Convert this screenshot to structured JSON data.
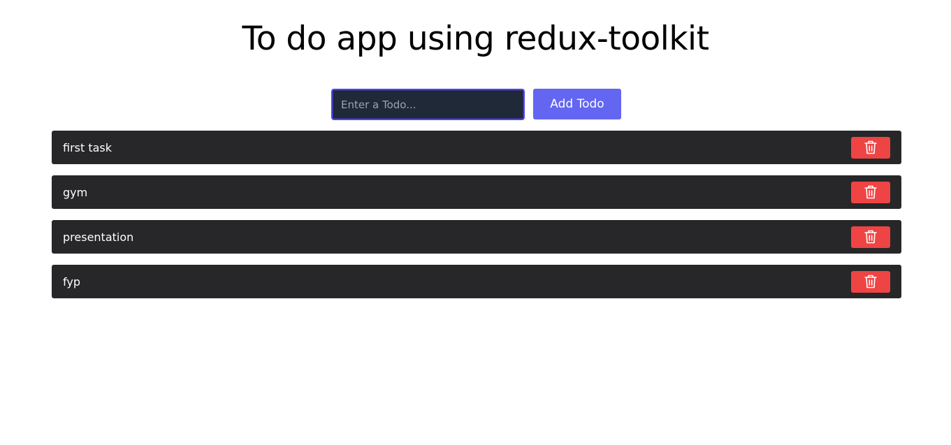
{
  "header": {
    "title": "To do app using redux-toolkit"
  },
  "form": {
    "input_value": "",
    "input_placeholder": "Enter a Todo...",
    "add_label": "Add Todo"
  },
  "todos": [
    {
      "text": "first task",
      "delete_icon": "trash-icon"
    },
    {
      "text": "gym",
      "delete_icon": "trash-icon"
    },
    {
      "text": "presentation",
      "delete_icon": "trash-icon"
    },
    {
      "text": "fyp",
      "delete_icon": "trash-icon"
    }
  ],
  "colors": {
    "accent": "#6366f1",
    "input_border": "#4f46e5",
    "input_background": "#1f2937",
    "item_background": "#27272a",
    "delete_button": "#ef4444"
  }
}
